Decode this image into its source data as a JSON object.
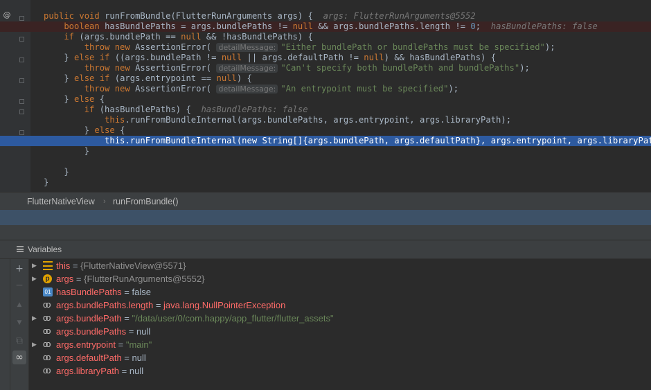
{
  "editor": {
    "lines": [
      {
        "tokens": [
          [
            "kw",
            "public void "
          ],
          [
            "fn",
            "runFromBundle(FlutterRunArguments args) {  "
          ],
          [
            "hint",
            "args: FlutterRunArguments@5552"
          ]
        ]
      },
      {
        "tokens": [
          [
            "kw",
            "    boolean "
          ],
          [
            "fn",
            "hasBundlePaths = args.bundlePaths != "
          ],
          [
            "kw",
            "null "
          ],
          [
            "fn",
            "&& args.bundlePaths.length != "
          ],
          [
            "num",
            "0"
          ],
          [
            "fn",
            ";  "
          ],
          [
            "hint",
            "hasBundlePaths: false"
          ]
        ]
      },
      {
        "tokens": [
          [
            "kw",
            "    if "
          ],
          [
            "fn",
            "(args.bundlePath == "
          ],
          [
            "kw",
            "null "
          ],
          [
            "fn",
            "&& !hasBundlePaths) {"
          ]
        ]
      },
      {
        "tokens": [
          [
            "kw",
            "        throw new "
          ],
          [
            "fn",
            "AssertionError( "
          ],
          [
            "param",
            "detailMessage:"
          ],
          [
            "str",
            "\"Either bundlePath or bundlePaths must be specified\""
          ],
          [
            "fn",
            ");"
          ]
        ]
      },
      {
        "tokens": [
          [
            "fn",
            "    } "
          ],
          [
            "kw",
            "else if "
          ],
          [
            "fn",
            "((args.bundlePath != "
          ],
          [
            "kw",
            "null "
          ],
          [
            "fn",
            "|| args.defaultPath != "
          ],
          [
            "kw",
            "null"
          ],
          [
            "fn",
            ") && hasBundlePaths) {"
          ]
        ]
      },
      {
        "tokens": [
          [
            "kw",
            "        throw new "
          ],
          [
            "fn",
            "AssertionError( "
          ],
          [
            "param",
            "detailMessage:"
          ],
          [
            "str",
            "\"Can't specify both bundlePath and bundlePaths\""
          ],
          [
            "fn",
            ");"
          ]
        ]
      },
      {
        "tokens": [
          [
            "fn",
            "    } "
          ],
          [
            "kw",
            "else if "
          ],
          [
            "fn",
            "(args.entrypoint == "
          ],
          [
            "kw",
            "null"
          ],
          [
            "fn",
            ") {"
          ]
        ]
      },
      {
        "tokens": [
          [
            "kw",
            "        throw new "
          ],
          [
            "fn",
            "AssertionError( "
          ],
          [
            "param",
            "detailMessage:"
          ],
          [
            "str",
            "\"An entrypoint must be specified\""
          ],
          [
            "fn",
            ");"
          ]
        ]
      },
      {
        "tokens": [
          [
            "fn",
            "    } "
          ],
          [
            "kw",
            "else "
          ],
          [
            "fn",
            "{"
          ]
        ]
      },
      {
        "tokens": [
          [
            "kw",
            "        if "
          ],
          [
            "fn",
            "(hasBundlePaths) {  "
          ],
          [
            "hint",
            "hasBundlePaths: false"
          ]
        ]
      },
      {
        "tokens": [
          [
            "kw",
            "            this"
          ],
          [
            "fn",
            ".runFromBundleInternal(args.bundlePaths, args.entrypoint, args.libraryPath);"
          ]
        ]
      },
      {
        "tokens": [
          [
            "fn",
            "        } "
          ],
          [
            "kw",
            "else "
          ],
          [
            "fn",
            "{"
          ]
        ]
      },
      {
        "tokens": [
          [
            "kw",
            "            this"
          ],
          [
            "fn",
            ".runFromBundleInternal("
          ],
          [
            "kw",
            "new "
          ],
          [
            "fn",
            "String[]{args.bundlePath, args.defaultPath}, args.entrypoint, args.libraryPath);  a"
          ]
        ]
      },
      {
        "tokens": [
          [
            "fn",
            "        }"
          ]
        ]
      },
      {
        "tokens": [
          [
            "fn",
            ""
          ]
        ]
      },
      {
        "tokens": [
          [
            "fn",
            "    }"
          ]
        ]
      },
      {
        "tokens": [
          [
            "fn",
            "}"
          ]
        ]
      }
    ]
  },
  "breadcrumb": {
    "class_name": "FlutterNativeView",
    "separator": "›",
    "method_name": "runFromBundle()"
  },
  "variables_panel": {
    "title": "Variables",
    "tools": [
      "+",
      "−",
      "▲",
      "▼",
      "⧉",
      "∞"
    ],
    "rows": [
      {
        "expandable": true,
        "icon": "fields-icon",
        "name": "this",
        "eq": " = ",
        "value": "{FlutterNativeView@5571}",
        "vtype": "obj"
      },
      {
        "expandable": true,
        "icon": "parameter-icon",
        "name": "args",
        "eq": " = ",
        "value": "{FlutterRunArguments@5552}",
        "vtype": "obj"
      },
      {
        "expandable": false,
        "icon": "local-var-icon",
        "name": "hasBundlePaths",
        "eq": " = ",
        "value": "false",
        "vtype": "plain"
      },
      {
        "expandable": false,
        "icon": "watch-icon",
        "name": "args.bundlePaths.length",
        "eq": " = ",
        "value": "java.lang.NullPointerException",
        "vtype": "exc"
      },
      {
        "expandable": true,
        "icon": "watch-icon",
        "name": "args.bundlePath",
        "eq": " = ",
        "value": "\"/data/user/0/com.happy/app_flutter/flutter_assets\"",
        "vtype": "str"
      },
      {
        "expandable": false,
        "icon": "watch-icon",
        "name": "args.bundlePaths",
        "eq": " = ",
        "value": "null",
        "vtype": "plain"
      },
      {
        "expandable": true,
        "icon": "watch-icon",
        "name": "args.entrypoint",
        "eq": " = ",
        "value": "\"main\"",
        "vtype": "str"
      },
      {
        "expandable": false,
        "icon": "watch-icon",
        "name": "args.defaultPath",
        "eq": " = ",
        "value": "null",
        "vtype": "plain"
      },
      {
        "expandable": false,
        "icon": "watch-icon",
        "name": "args.libraryPath",
        "eq": " = ",
        "value": "null",
        "vtype": "plain"
      }
    ]
  },
  "gutter": {
    "override_marker": "@"
  },
  "colors": {
    "keyword": "#cc7832",
    "string": "#6a8759",
    "number": "#6897bb",
    "exec_line": "#2d5aa0",
    "breakpoint": "#c75450",
    "var_name": "#ff6b68"
  }
}
